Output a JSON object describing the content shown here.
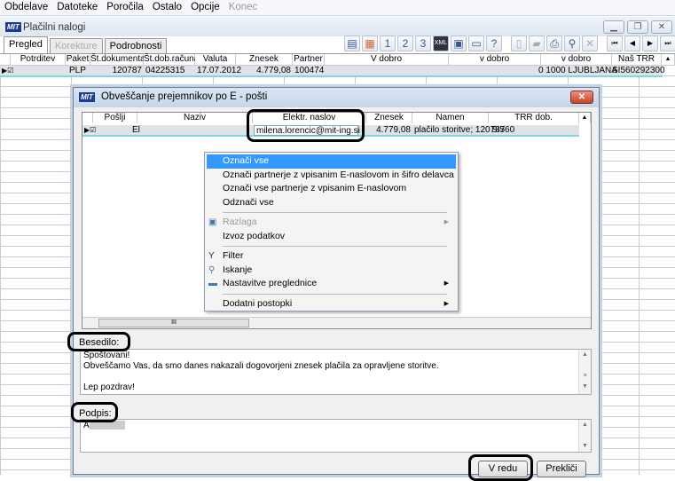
{
  "menu": [
    "Obdelave",
    "Datoteke",
    "Poročila",
    "Ostalo",
    "Opcije",
    "Konec"
  ],
  "window": {
    "title": "Plačilni nalogi",
    "logo": "MIT"
  },
  "tabs": [
    "Pregled",
    "Korekture",
    "Podrobnosti"
  ],
  "toolbar": [
    "1",
    "2",
    "3"
  ],
  "main_grid": {
    "columns": [
      "Potrditev",
      "Paket",
      "Št.dokumenta",
      "Št.dob.računa",
      "Valuta",
      "Znesek",
      "Partner",
      "V dobro",
      "v dobro",
      "v dobro",
      "Naš TRR"
    ],
    "row": {
      "paket": "PLP",
      "dokument": "120787",
      "racun": "04225315",
      "valuta": "17.07.2012",
      "znesek": "4.779,08",
      "partner": "100474",
      "vdobro3": "0 1000  LJUBLJANA",
      "trr": "SI560292300"
    }
  },
  "dialog": {
    "title": "Obveščanje prejemnikov po E - pošti",
    "columns": [
      "Pošlji",
      "Naziv",
      "Elektr. naslov",
      "Znesek",
      "Namen",
      "TRR dob."
    ],
    "row": {
      "naziv": "El",
      "email": "milena.lorencic@mit-ing.si",
      "znesek": "4.779,08",
      "namen": "plačilo storitve; 120787",
      "trr": "SI560"
    },
    "besedilo_label": "Besedilo:",
    "besedilo": [
      "Spoštovani!",
      "Obveščamo Vas, da smo danes nakazali dogovorjeni znesek plačila za  opravljene storitve.",
      "",
      "Lep pozdrav!"
    ],
    "podpis_label": "Podpis:",
    "podpis": "A",
    "ok": "V redu",
    "cancel": "Prekliči"
  },
  "context_menu": [
    "Označi vse",
    "Označi partnerje z vpisanim E-naslovom in šifro delavca",
    "Označi vse partnerje z vpisanim E-naslovom",
    "Odznači vse",
    "Razlaga",
    "Izvoz podatkov",
    "Filter",
    "Iskanje",
    "Nastavitve preglednice",
    "Dodatni postopki"
  ]
}
